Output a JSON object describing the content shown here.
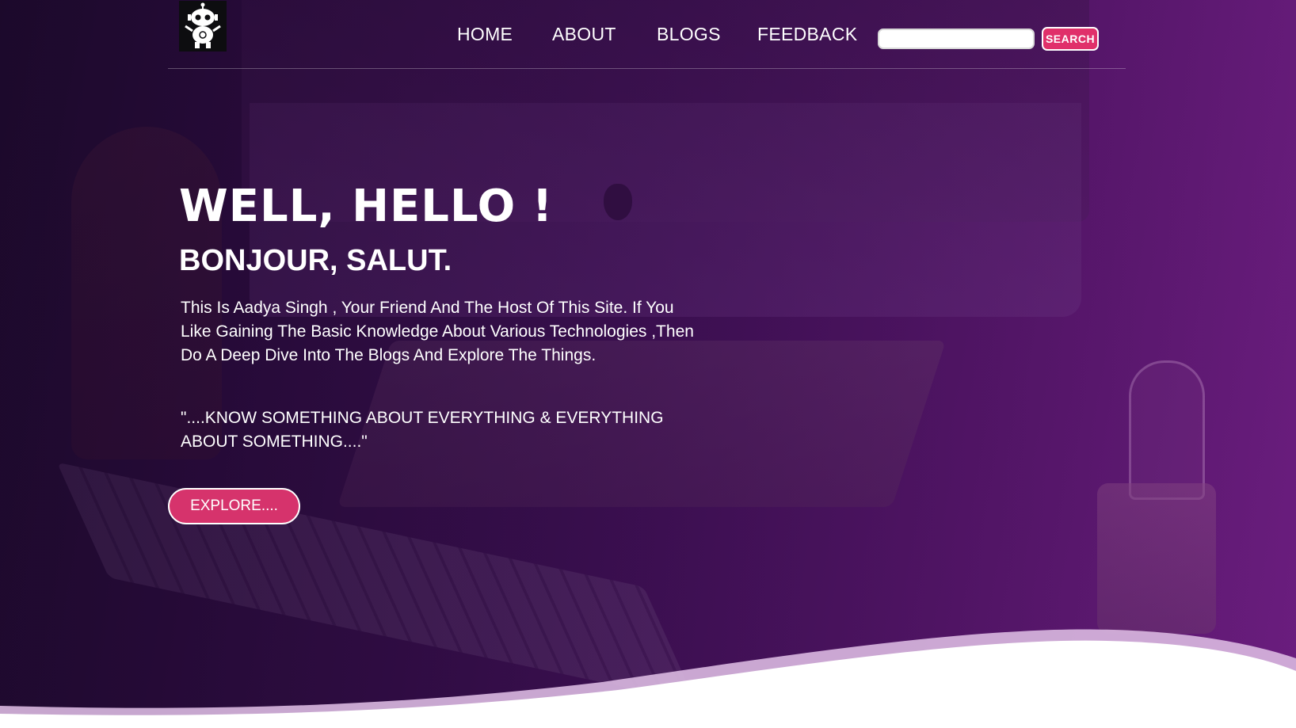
{
  "header": {
    "logo_name": "robot-logo",
    "nav": [
      {
        "label": "HOME"
      },
      {
        "label": "ABOUT"
      },
      {
        "label": "BLOGS"
      },
      {
        "label": "FEEDBACK"
      }
    ],
    "search": {
      "value": "",
      "button_label": "SEARCH"
    }
  },
  "hero": {
    "title": "WELL, HELLO !",
    "subtitle": "BONJOUR, SALUT.",
    "intro": "This Is Aadya Singh , Your Friend And The Host Of This Site. If You Like Gaining The Basic Knowledge About Various Technologies ,Then Do A Deep Dive Into The Blogs And Explore The Things.",
    "quote": "\"....KNOW SOMETHING ABOUT EVERYTHING & EVERYTHING ABOUT SOMETHING....\"",
    "cta_label": "EXPLORE...."
  },
  "colors": {
    "accent": "#e0306a",
    "background_dark": "#1c0a2a",
    "background_purple": "#6a1d7c",
    "text": "#ffffff"
  }
}
